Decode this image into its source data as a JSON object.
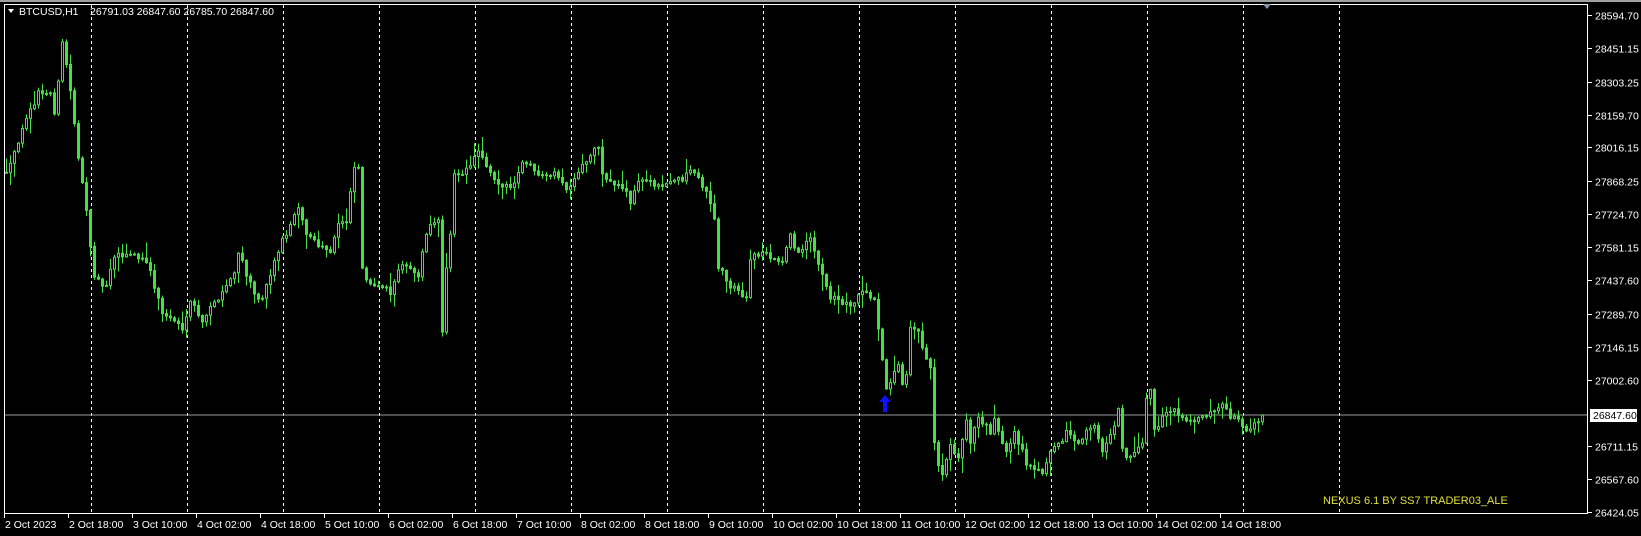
{
  "header": {
    "symbol": "BTCUSD,H1",
    "ohlc": "26791.03 26847.60 26785.70 26847.60"
  },
  "watermark": "NEXUS 6.1 BY SS7 TRADER03_ALE",
  "colors": {
    "background": "#000000",
    "candle": "#46e046",
    "grid": "#ffffff",
    "price_line": "#9a9a9a",
    "signal_arrow": "#1010ff",
    "watermark": "#e2e23a"
  },
  "chart_data": {
    "type": "candlestick",
    "title": "BTCUSD,H1",
    "timeframe": "H1",
    "ylim": [
      26424.05,
      28594.7
    ],
    "y_ticks": [
      "28594.70",
      "28451.15",
      "28303.25",
      "28159.70",
      "28016.15",
      "27868.25",
      "27724.70",
      "27581.15",
      "27437.60",
      "27289.70",
      "27146.15",
      "27002.60",
      "26711.15",
      "26567.60",
      "26424.05"
    ],
    "current_price": "26847.60",
    "x_labels": [
      "2 Oct 2023",
      "2 Oct 18:00",
      "3 Oct 10:00",
      "4 Oct 02:00",
      "4 Oct 18:00",
      "5 Oct 10:00",
      "6 Oct 02:00",
      "6 Oct 18:00",
      "7 Oct 10:00",
      "8 Oct 02:00",
      "8 Oct 18:00",
      "9 Oct 10:00",
      "10 Oct 02:00",
      "10 Oct 18:00",
      "11 Oct 10:00",
      "12 Oct 02:00",
      "12 Oct 18:00",
      "13 Oct 10:00",
      "14 Oct 02:00",
      "14 Oct 18:00"
    ],
    "x_label_every_bars": 16,
    "grid": "vertical dashed at each day start",
    "bar_count": 315,
    "signal": {
      "type": "buy-arrow",
      "bar_index": 220
    },
    "close_path": [
      [
        0,
        27918
      ],
      [
        8,
        28258
      ],
      [
        11,
        28254
      ],
      [
        12,
        28149
      ],
      [
        14,
        28485
      ],
      [
        16,
        28267
      ],
      [
        18,
        27961
      ],
      [
        20,
        27756
      ],
      [
        22,
        27437
      ],
      [
        25,
        27407
      ],
      [
        27,
        27538
      ],
      [
        31,
        27555
      ],
      [
        35,
        27525
      ],
      [
        39,
        27293
      ],
      [
        44,
        27232
      ],
      [
        46,
        27350
      ],
      [
        49,
        27263
      ],
      [
        53,
        27363
      ],
      [
        57,
        27468
      ],
      [
        58,
        27568
      ],
      [
        62,
        27363
      ],
      [
        64,
        27350
      ],
      [
        68,
        27568
      ],
      [
        70,
        27643
      ],
      [
        73,
        27743
      ],
      [
        75,
        27643
      ],
      [
        79,
        27582
      ],
      [
        81,
        27568
      ],
      [
        83,
        27686
      ],
      [
        85,
        27686
      ],
      [
        87,
        27931
      ],
      [
        88,
        27918
      ],
      [
        89,
        27494
      ],
      [
        90,
        27424
      ],
      [
        93,
        27424
      ],
      [
        96,
        27380
      ],
      [
        98,
        27468
      ],
      [
        100,
        27512
      ],
      [
        103,
        27450
      ],
      [
        105,
        27643
      ],
      [
        108,
        27712
      ],
      [
        109,
        27206
      ],
      [
        110,
        27481
      ],
      [
        111,
        27625
      ],
      [
        112,
        27896
      ],
      [
        115,
        27918
      ],
      [
        118,
        27996
      ],
      [
        120,
        27926
      ],
      [
        123,
        27843
      ],
      [
        127,
        27861
      ],
      [
        129,
        27961
      ],
      [
        133,
        27909
      ],
      [
        138,
        27896
      ],
      [
        140,
        27830
      ],
      [
        143,
        27918
      ],
      [
        146,
        27975
      ],
      [
        148,
        28027
      ],
      [
        149,
        27896
      ],
      [
        151,
        27861
      ],
      [
        155,
        27830
      ],
      [
        156,
        27774
      ],
      [
        158,
        27874
      ],
      [
        160,
        27874
      ],
      [
        163,
        27839
      ],
      [
        166,
        27874
      ],
      [
        169,
        27874
      ],
      [
        171,
        27918
      ],
      [
        173,
        27883
      ],
      [
        175,
        27817
      ],
      [
        177,
        27712
      ],
      [
        178,
        27494
      ],
      [
        181,
        27407
      ],
      [
        185,
        27363
      ],
      [
        186,
        27538
      ],
      [
        189,
        27555
      ],
      [
        194,
        27516
      ],
      [
        196,
        27625
      ],
      [
        198,
        27555
      ],
      [
        201,
        27612
      ],
      [
        204,
        27468
      ],
      [
        206,
        27363
      ],
      [
        211,
        27319
      ],
      [
        214,
        27380
      ],
      [
        217,
        27350
      ],
      [
        219,
        27075
      ],
      [
        220,
        26970
      ],
      [
        223,
        27057
      ],
      [
        224,
        26970
      ],
      [
        225,
        27013
      ],
      [
        226,
        27219
      ],
      [
        228,
        27219
      ],
      [
        229,
        27132
      ],
      [
        231,
        27044
      ],
      [
        232,
        26725
      ],
      [
        233,
        26621
      ],
      [
        234,
        26577
      ],
      [
        236,
        26708
      ],
      [
        238,
        26665
      ],
      [
        240,
        26813
      ],
      [
        241,
        26738
      ],
      [
        243,
        26839
      ],
      [
        246,
        26769
      ],
      [
        247,
        26817
      ],
      [
        250,
        26695
      ],
      [
        252,
        26782
      ],
      [
        255,
        26638
      ],
      [
        257,
        26617
      ],
      [
        259,
        26586
      ],
      [
        260,
        26652
      ],
      [
        262,
        26695
      ],
      [
        265,
        26769
      ],
      [
        268,
        26738
      ],
      [
        272,
        26813
      ],
      [
        274,
        26682
      ],
      [
        276,
        26752
      ],
      [
        278,
        26870
      ],
      [
        279,
        26695
      ],
      [
        280,
        26652
      ],
      [
        283,
        26695
      ],
      [
        284,
        26725
      ],
      [
        285,
        26926
      ],
      [
        286,
        26957
      ],
      [
        287,
        26782
      ],
      [
        289,
        26839
      ],
      [
        292,
        26878
      ],
      [
        294,
        26839
      ],
      [
        297,
        26817
      ],
      [
        299,
        26834
      ],
      [
        302,
        26856
      ],
      [
        304,
        26883
      ],
      [
        306,
        26839
      ],
      [
        308,
        26817
      ],
      [
        310,
        26782
      ],
      [
        312,
        26800
      ],
      [
        314,
        26847.6
      ]
    ]
  }
}
